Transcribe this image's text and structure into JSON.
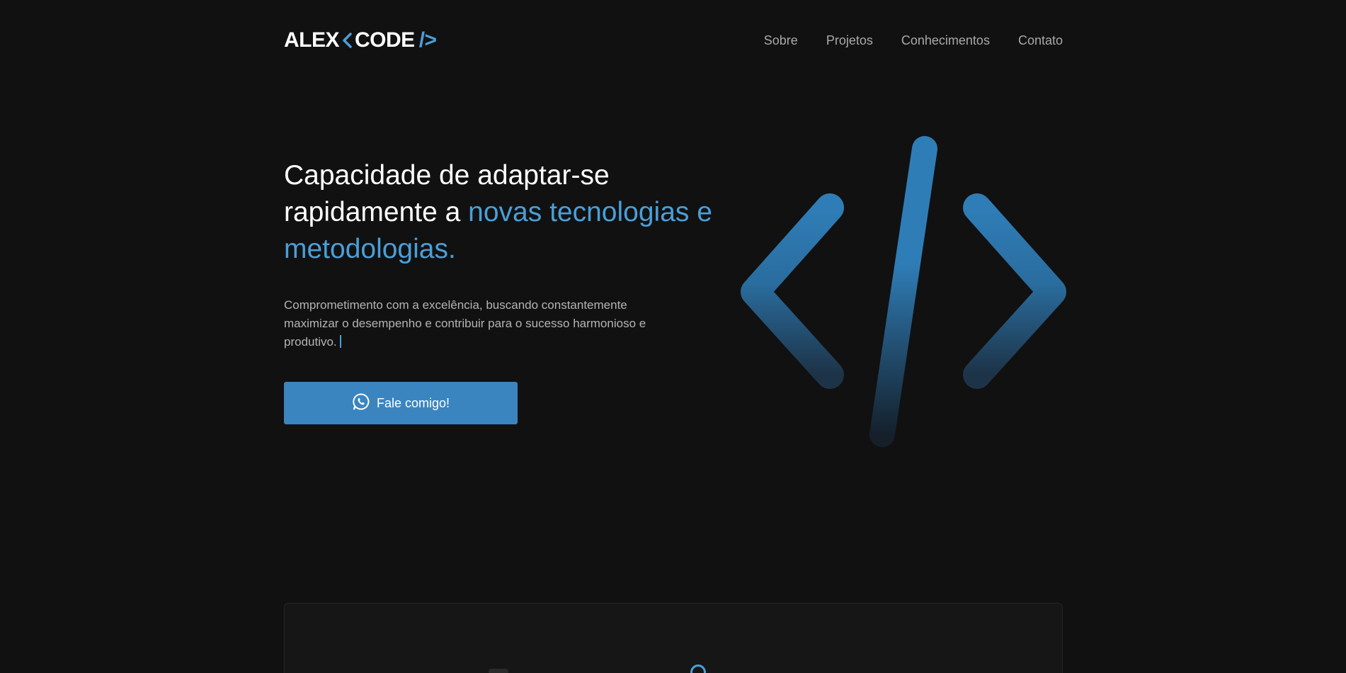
{
  "header": {
    "logo": {
      "part1": "ALEX",
      "part2": "CODE",
      "part3": "/>"
    },
    "nav": [
      {
        "label": "Sobre"
      },
      {
        "label": "Projetos"
      },
      {
        "label": "Conhecimentos"
      },
      {
        "label": "Contato"
      }
    ]
  },
  "hero": {
    "title_plain": "Capacidade de adaptar-se rapidamente a ",
    "title_accent": "novas tecnologias e metodologias.",
    "description": "Comprometimento com a excelência, buscando constantemente maximizar o desempenho e contribuir para o sucesso harmonioso e produtivo.",
    "cta_label": "Fale comigo!",
    "cta_icon": "whatsapp-icon",
    "art_icon": "code-brackets-icon"
  },
  "colors": {
    "background": "#111111",
    "accent": "#4a9fd8",
    "button": "#3a85c0",
    "nav_text": "#a9a9a9",
    "body_text": "#b4b4b4"
  }
}
